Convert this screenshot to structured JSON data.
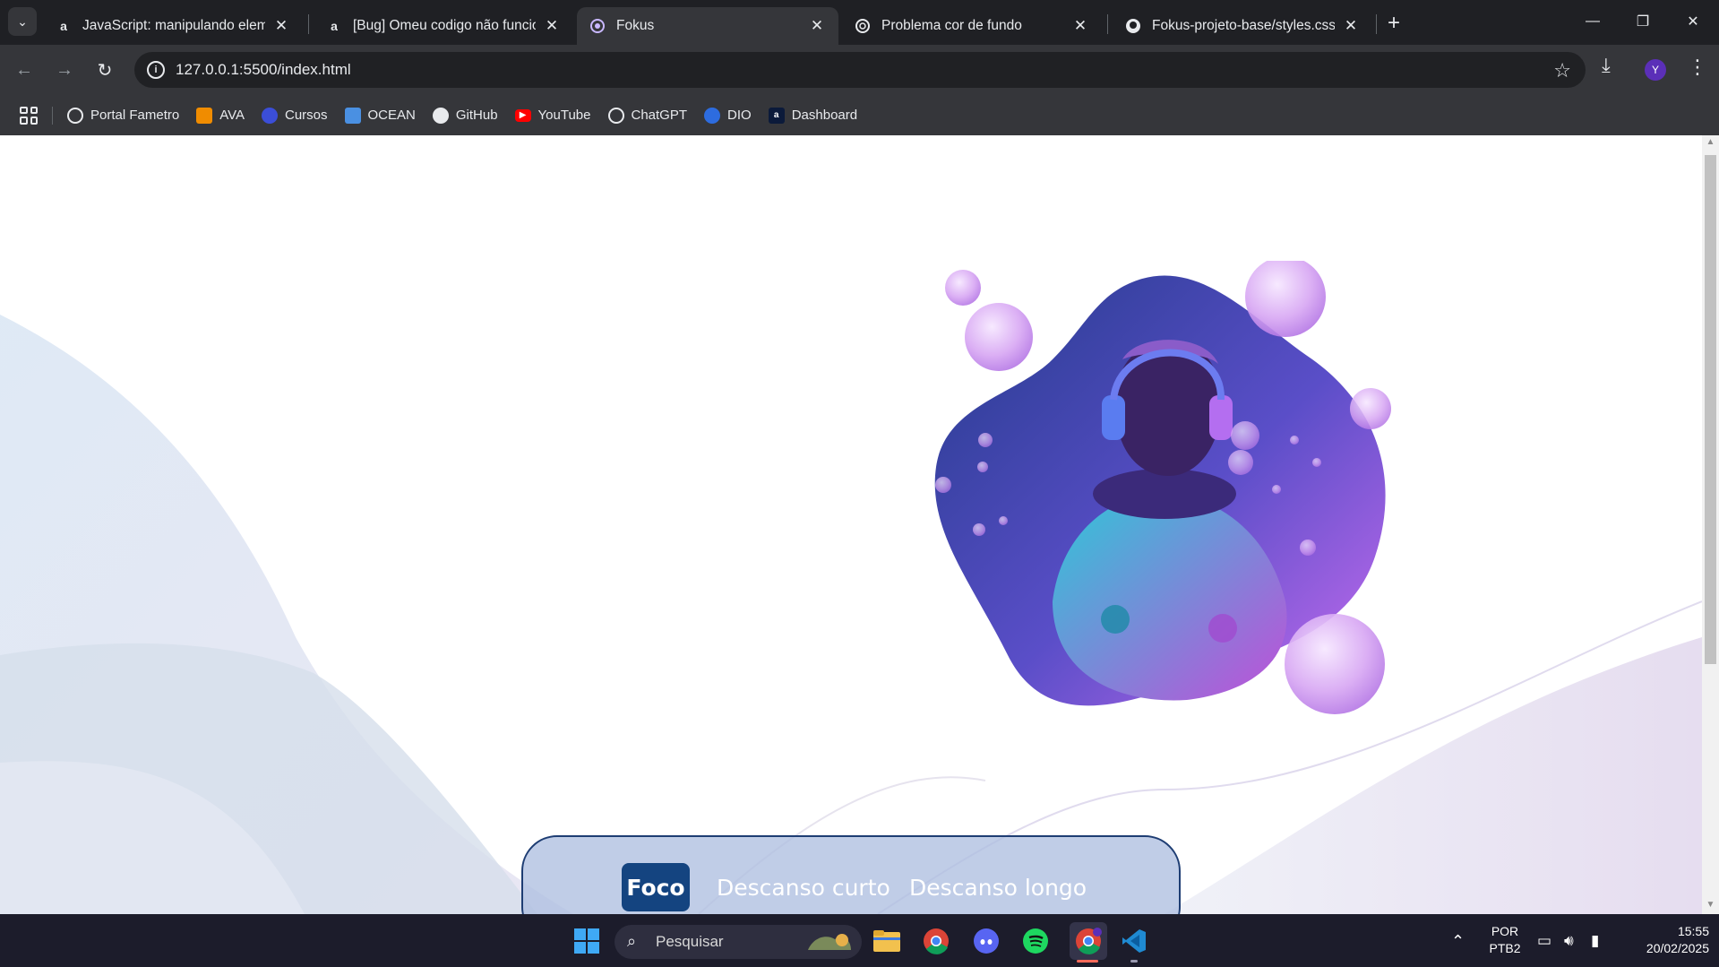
{
  "browser": {
    "tabs": [
      {
        "title": "JavaScript: manipulando elemen",
        "favicon": "a"
      },
      {
        "title": "[Bug] Omeu codigo não funcion",
        "favicon": "a"
      },
      {
        "title": "Fokus",
        "favicon": "fokus-icon",
        "active": true
      },
      {
        "title": "Problema cor de fundo",
        "favicon": "chatgpt-icon"
      },
      {
        "title": "Fokus-projeto-base/styles.css a",
        "favicon": "github-icon"
      }
    ],
    "url": "127.0.0.1:5500/index.html",
    "profile_initial": "Y",
    "bookmarks": [
      {
        "label": "Portal Fametro",
        "color": "#9aa0a6"
      },
      {
        "label": "AVA",
        "color": "#f08c00"
      },
      {
        "label": "Cursos",
        "color": "#3b4ed8"
      },
      {
        "label": "OCEAN",
        "color": "#4a90e2"
      },
      {
        "label": "GitHub",
        "color": "#e8eaed"
      },
      {
        "label": "YouTube",
        "color": "#ff0000"
      },
      {
        "label": "ChatGPT",
        "color": "#e8eaed"
      },
      {
        "label": "DIO",
        "color": "#2d6cdf"
      },
      {
        "label": "Dashboard",
        "color": "#0b1a3a"
      }
    ]
  },
  "app": {
    "modes": {
      "focus": "Foco",
      "short_break": "Descanso curto",
      "long_break": "Descanso longo"
    },
    "accent": "#144480"
  },
  "taskbar": {
    "search_placeholder": "Pesquisar",
    "lang_line1": "POR",
    "lang_line2": "PTB2",
    "time": "15:55",
    "date": "20/02/2025"
  }
}
